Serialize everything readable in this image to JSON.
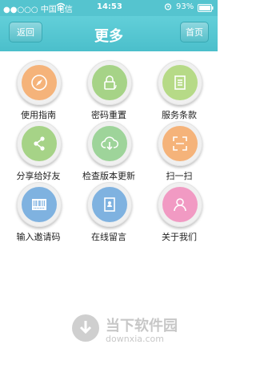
{
  "status": {
    "carrier": "●●○○○ 中国电信",
    "time": "14:53",
    "battery": "93%"
  },
  "nav": {
    "title": "更多",
    "back_label": "返回",
    "home_label": "首页"
  },
  "items": [
    {
      "label": "使用指南",
      "color": "#f5b37a",
      "icon": "compass-icon"
    },
    {
      "label": "密码重置",
      "color": "#a6d387",
      "icon": "lock-icon"
    },
    {
      "label": "服务条款",
      "color": "#b6da87",
      "icon": "document-icon"
    },
    {
      "label": "分享给好友",
      "color": "#a6d387",
      "icon": "share-icon"
    },
    {
      "label": "检查版本更新",
      "color": "#9ed49a",
      "icon": "cloud-download-icon"
    },
    {
      "label": "扫一扫",
      "color": "#f5b37a",
      "icon": "scan-icon"
    },
    {
      "label": "输入邀请码",
      "color": "#7fb2e0",
      "icon": "barcode-icon"
    },
    {
      "label": "在线留言",
      "color": "#7fb2e0",
      "icon": "message-icon"
    },
    {
      "label": "关于我们",
      "color": "#f19ac3",
      "icon": "person-icon"
    }
  ],
  "watermark": {
    "title": "当下软件园",
    "sub": "downxia.com"
  }
}
